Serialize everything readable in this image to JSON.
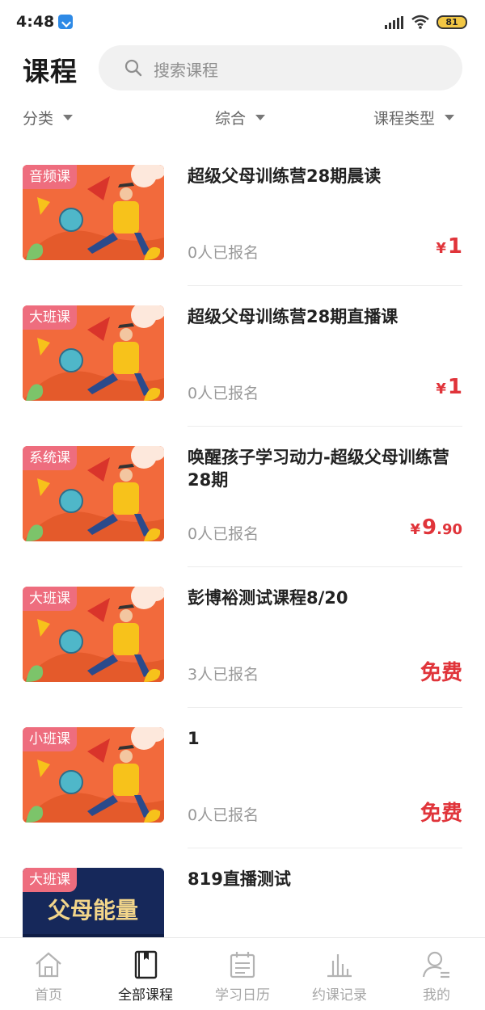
{
  "status_bar": {
    "time": "4:48",
    "battery": "81"
  },
  "header": {
    "title": "课程",
    "search_placeholder": "搜索课程"
  },
  "filters": {
    "category": "分类",
    "sort": "综合",
    "type": "课程类型"
  },
  "courses": [
    {
      "tag": "音频课",
      "title": "超级父母训练营28期晨读",
      "enrolled": "0人已报名",
      "price_symbol": "¥",
      "price_main": "1",
      "price_cents": "",
      "thumb": "cartoon"
    },
    {
      "tag": "大班课",
      "title": "超级父母训练营28期直播课",
      "enrolled": "0人已报名",
      "price_symbol": "¥",
      "price_main": "1",
      "price_cents": "",
      "thumb": "cartoon"
    },
    {
      "tag": "系统课",
      "title": "唤醒孩子学习动力-超级父母训练营28期",
      "enrolled": "0人已报名",
      "price_symbol": "¥",
      "price_main": "9",
      "price_cents": ".90",
      "thumb": "cartoon"
    },
    {
      "tag": "大班课",
      "title": "彭博裕测试课程8/20",
      "enrolled": "3人已报名",
      "price_symbol": "",
      "price_main": "免费",
      "price_cents": "",
      "thumb": "cartoon"
    },
    {
      "tag": "小班课",
      "title": "1",
      "enrolled": "0人已报名",
      "price_symbol": "",
      "price_main": "免费",
      "price_cents": "",
      "thumb": "cartoon"
    },
    {
      "tag": "大班课",
      "title": "819直播测试",
      "enrolled": "",
      "price_symbol": "",
      "price_main": "",
      "price_cents": "",
      "thumb": "banner",
      "banner_text": "父母能量"
    }
  ],
  "tabs": [
    {
      "label": "首页",
      "icon": "home-icon",
      "active": false
    },
    {
      "label": "全部课程",
      "icon": "book-icon",
      "active": true
    },
    {
      "label": "学习日历",
      "icon": "calendar-icon",
      "active": false
    },
    {
      "label": "约课记录",
      "icon": "bar-chart-icon",
      "active": false
    },
    {
      "label": "我的",
      "icon": "user-icon",
      "active": false
    }
  ],
  "colors": {
    "accent": "#e0343a",
    "tag": "#ee6d7e",
    "thumb_bg": "#f26a3c"
  }
}
